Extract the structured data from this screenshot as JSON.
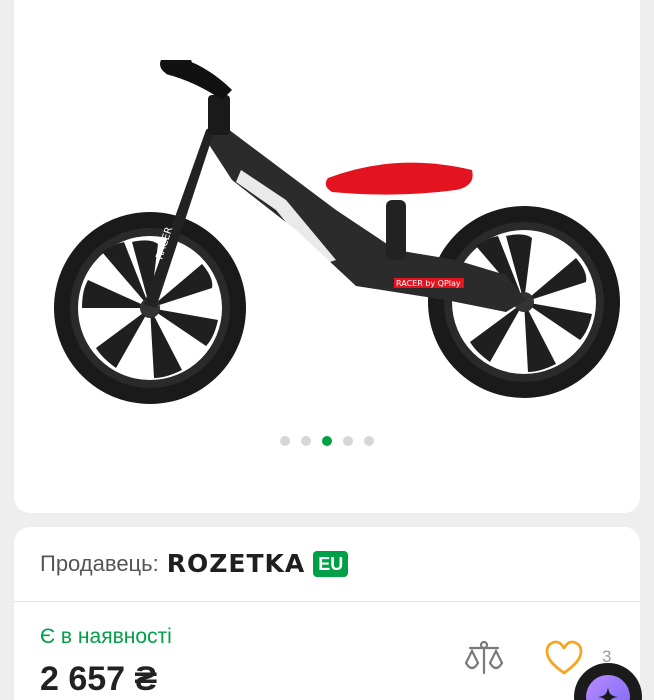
{
  "gallery": {
    "image_alt": "RACER by QPlay",
    "bike_brand_text": "RACER",
    "bike_frame_text": "RACER by QPlay",
    "dots_count": 5,
    "active_dot": 2
  },
  "seller": {
    "label": "Продавець:",
    "name": "ROZETKA",
    "badge": "EU"
  },
  "product": {
    "availability": "Є в наявності",
    "price": "2 657 ₴",
    "wishlist_count": "3"
  },
  "icons": {
    "compare": "scales-icon",
    "wishlist": "heart-icon",
    "assistant": "sparkle-icon"
  },
  "colors": {
    "accent_green": "#00a046",
    "wishlist_orange": "#f5a623",
    "seat_red": "#e3141f"
  }
}
